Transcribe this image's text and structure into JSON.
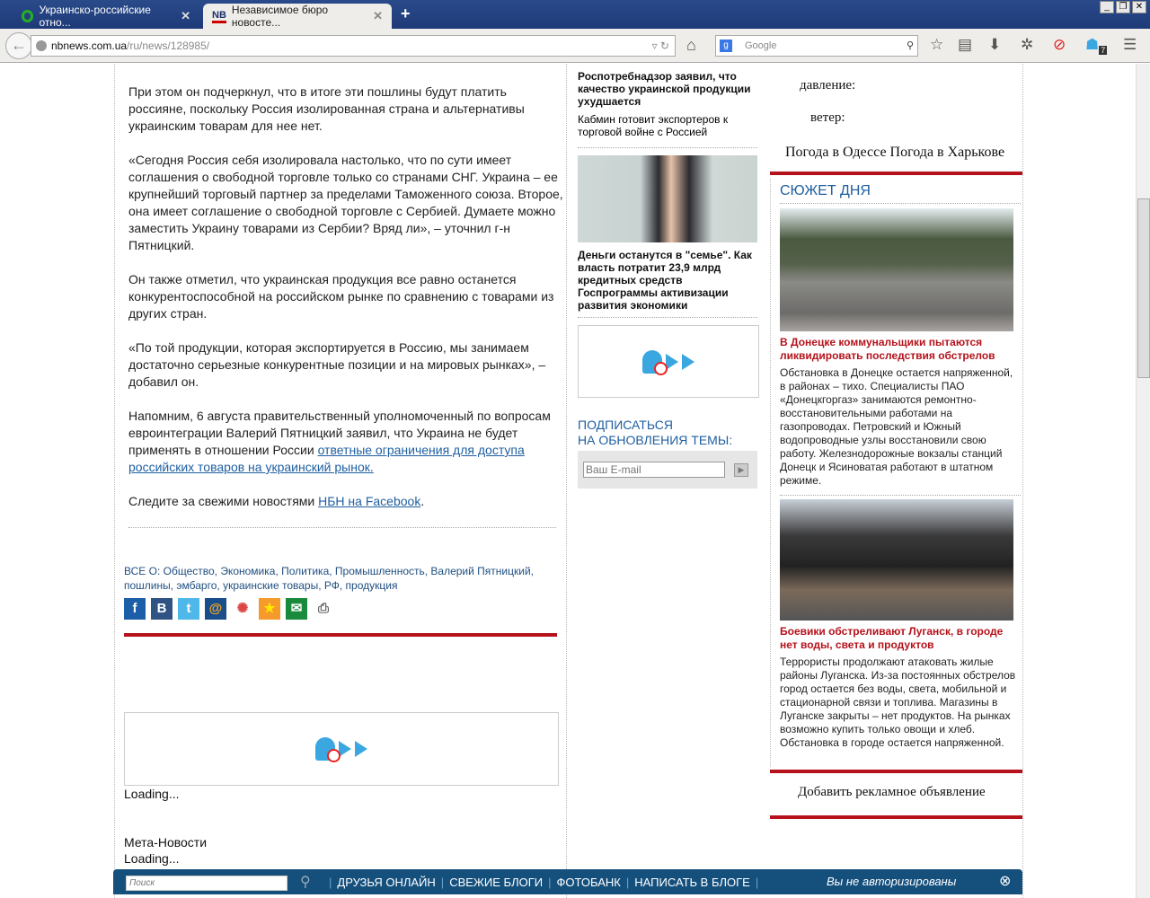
{
  "browser": {
    "tabs": [
      {
        "title": "Украинско-российские отно..."
      },
      {
        "title": "Независимое бюро новосте..."
      }
    ],
    "url_host": "nbnews.com.ua",
    "url_path": "/ru/news/128985/",
    "search_placeholder": "Google",
    "badge": "7"
  },
  "article": {
    "paragraphs": [
      "При этом он подчеркнул, что в итоге эти пошлины будут платить россияне, поскольку Россия изолированная страна и альтернативы украинским товарам для нее нет.",
      "«Сегодня Россия себя изолировала настолько, что по сути имеет соглашения о свободной торговле только со странами СНГ. Украина – ее крупнейший торговый партнер за пределами Таможенного союза. Второе, она имеет соглашение о свободной торговле с Сербией. Думаете можно заместить Украину товарами из Сербии? Вряд ли», – уточнил г-н Пятницкий.",
      "Он также отметил, что украинская продукция все равно останется конкурентоспособной на российском рынке по сравнению с товарами из других стран.",
      "«По той продукции, которая экспортируется в Россию, мы занимаем достаточно серьезные конкурентные позиции и на мировых рынках», – добавил он."
    ],
    "p5_text": "Напомним, 6 августа правительственный уполномоченный по вопросам евроинтеграции Валерий Пятницкий заявил, что Украина не будет применять в отношении России ",
    "p5_link": "ответные ограничения для доступа российских товаров на украинский рынок.",
    "p6_text": "Следите за свежими новостями ",
    "p6_link": "НБН на Facebook",
    "p6_end": ".",
    "tags_label": "ВСЕ О:",
    "tags": "Общество, Экономика, Политика, Промышленность, Валерий Пятницкий, пошлины, эмбарго, украинские товары, РФ, продукция",
    "loading1": "Loading...",
    "meta_title": "Мета-Новости",
    "loading2": "Loading..."
  },
  "middle": {
    "headline1": "Роспотребнадзор заявил, что качество украинской продукции ухудшается",
    "link1": "Кабмин готовит экспортеров к торговой войне с Россией",
    "photo_caption": "Деньги останутся в \"семье\". Как власть потратит 23,9 млрд кредитных средств Госпрограммы активизации развития экономики",
    "subscribe1": "ПОДПИСАТЬСЯ",
    "subscribe2": "НА ОБНОВЛЕНИЯ ТЕМЫ:",
    "email_placeholder": "Ваш E-mail"
  },
  "weather": {
    "pressure": "давление:",
    "wind": "ветер:",
    "odessa": "Погода в Одессе",
    "kharkiv": "Погода в Харькове"
  },
  "story": {
    "title": "СЮЖЕТ ДНЯ",
    "items": [
      {
        "title": "В Донецке коммунальщики пытаются ликвидировать последствия обстрелов",
        "text": "Обстановка в Донецке остается напряженной, в районах – тихо. Специалисты ПАО «Донецкгоргаз» занимаются ремонтно-восстановительными работами на газопроводах. Петровский и Южный водопроводные узлы восстановили свою работу. Железнодорожные вокзалы станций Донецк и Ясиноватая работают в штатном режиме."
      },
      {
        "title": "Боевики обстреливают Луганск, в городе нет воды, света и продуктов",
        "text": "Террористы продолжают атаковать жилые районы Луганска. Из-за постоянных обстрелов город остается без воды, света, мобильной и стационарной связи и топлива. Магазины в Луганске закрыты – нет продуктов. На рынках возможно купить только овощи и хлеб. Обстановка в городе остается напряженной."
      }
    ],
    "ad_link": "Добавить рекламное объявление"
  },
  "bottombar": {
    "search_placeholder": "Поиск",
    "links": [
      "ДРУЗЬЯ ОНЛАЙН",
      "СВЕЖИЕ БЛОГИ",
      "ФОТОБАНК",
      "НАПИСАТЬ В БЛОГЕ"
    ],
    "status": "Вы не авторизированы"
  },
  "colors": {
    "accent_red": "#b5121b",
    "link_blue": "#1f5fa0",
    "bar_blue": "#15507d"
  }
}
